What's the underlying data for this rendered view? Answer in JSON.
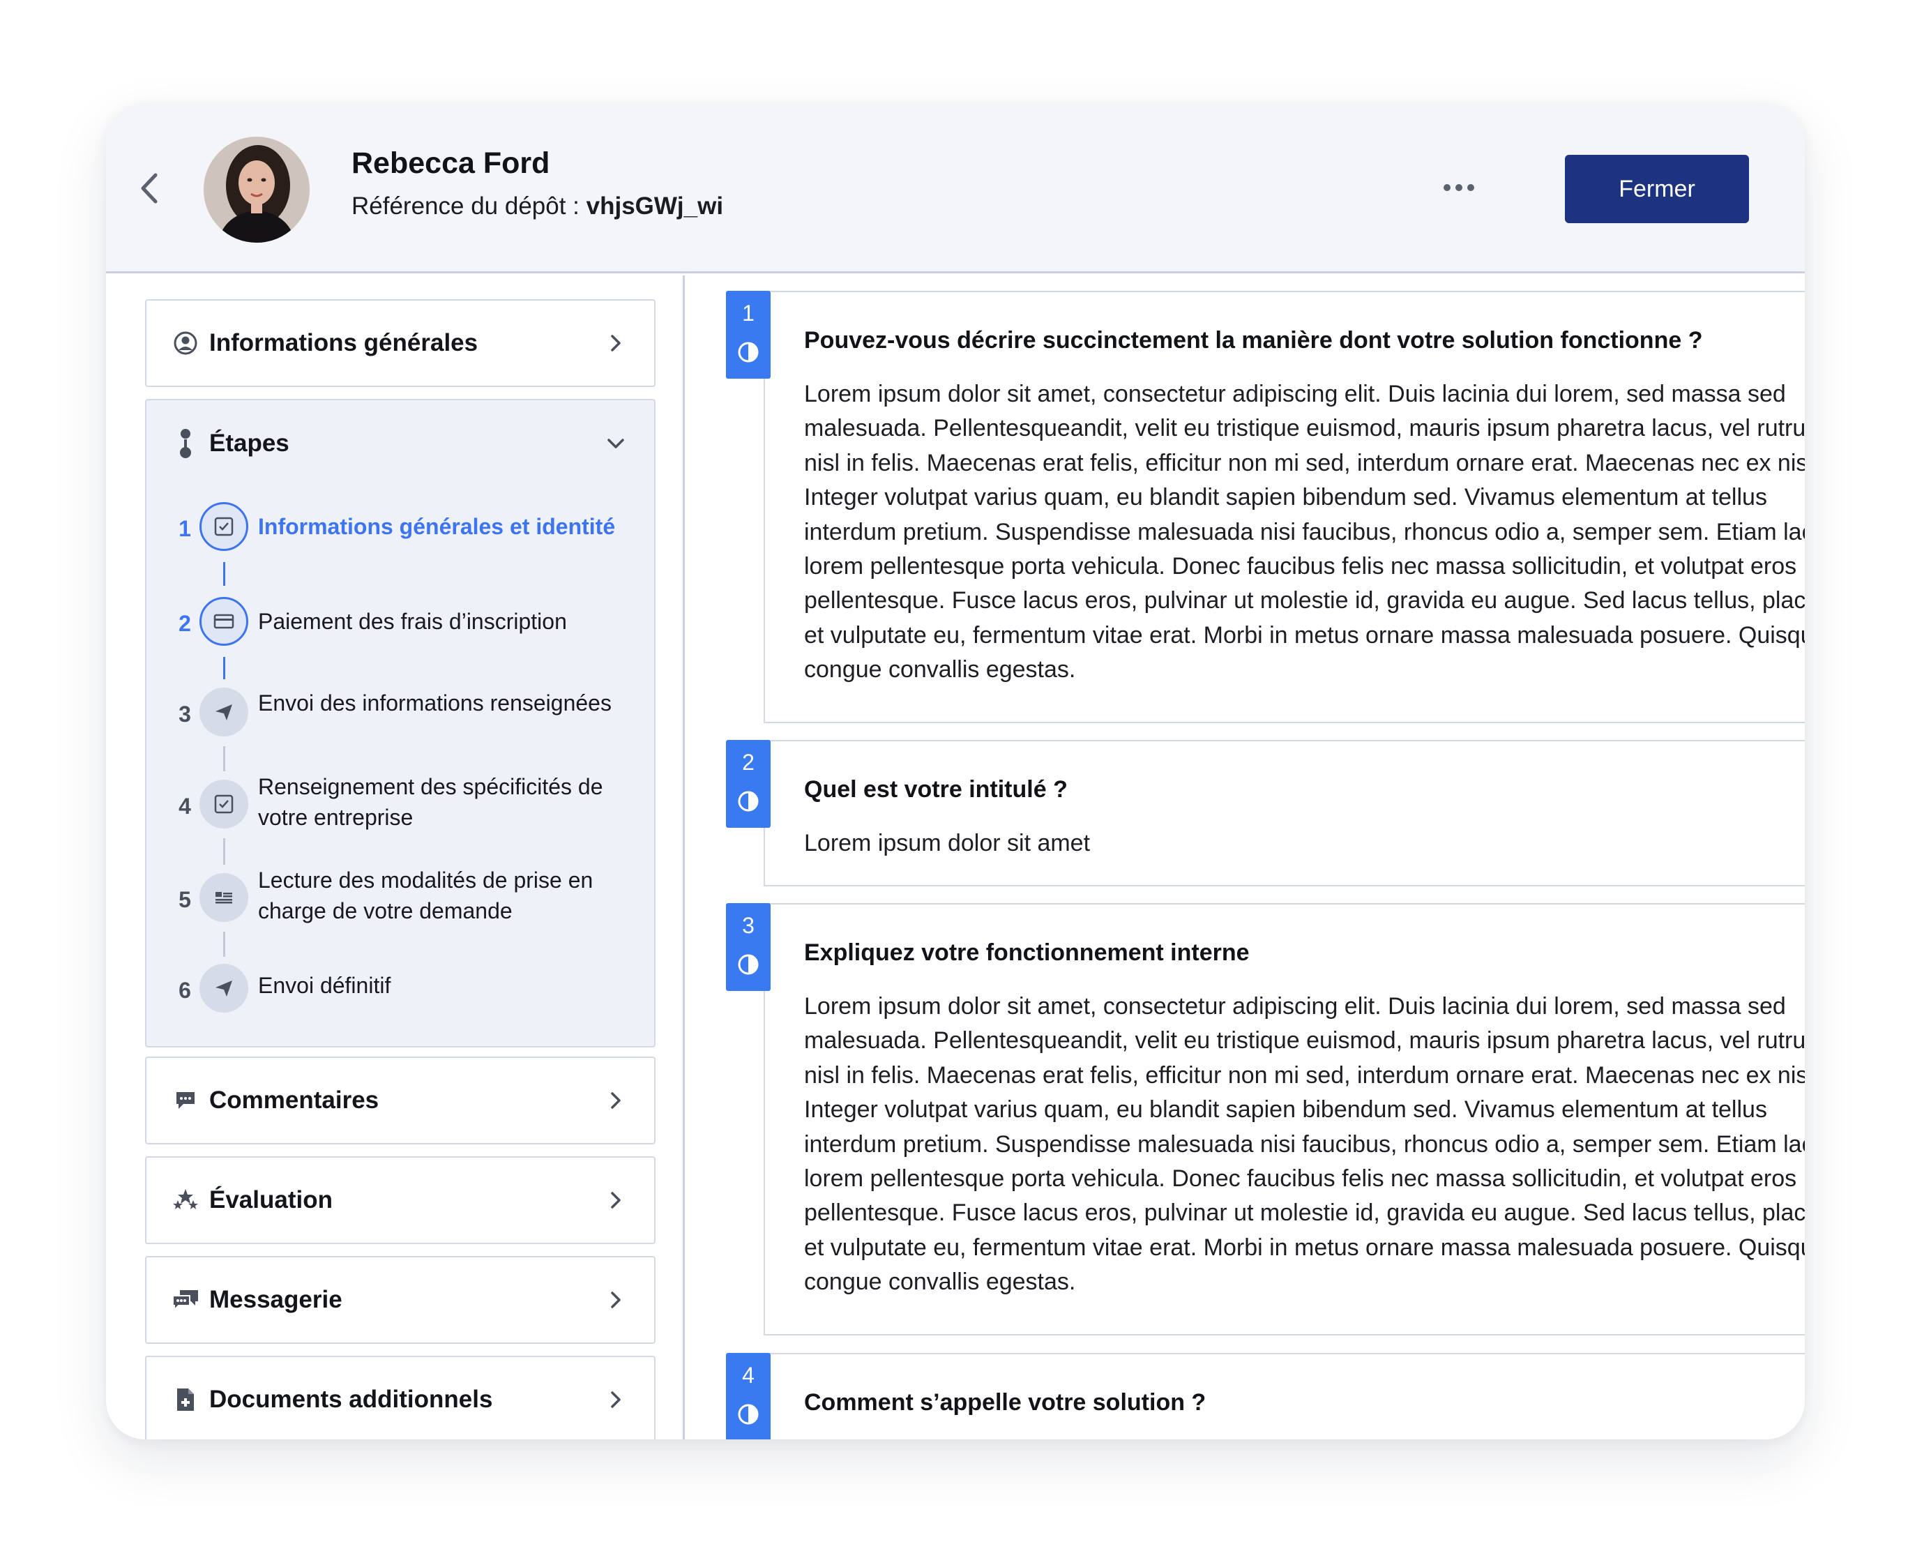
{
  "header": {
    "user_name": "Rebecca Ford",
    "reference_label": "Référence du dépôt : ",
    "reference_value": "vhjsGWj_wi",
    "close_label": "Fermer"
  },
  "sidebar": {
    "general_info": "Informations générales",
    "steps_title": "Étapes",
    "steps": [
      {
        "num": "1",
        "label": "Informations générales et identité",
        "icon": "checkbox-icon"
      },
      {
        "num": "2",
        "label": "Paiement des frais d’inscription",
        "icon": "credit-card-icon"
      },
      {
        "num": "3",
        "label": "Envoi des informations renseignées",
        "icon": "send-icon"
      },
      {
        "num": "4",
        "label": "Renseignement des spécificités de votre entreprise",
        "icon": "checkbox-icon"
      },
      {
        "num": "5",
        "label": "Lecture des modalités de prise en charge de votre demande",
        "icon": "document-list-icon"
      },
      {
        "num": "6",
        "label": "Envoi définitif",
        "icon": "send-icon"
      }
    ],
    "comments": "Commentaires",
    "evaluation": "Évaluation",
    "messaging": "Messagerie",
    "additional_docs": "Documents additionnels"
  },
  "questions": [
    {
      "num": "1",
      "title": "Pouvez-vous décrire succinctement la manière dont votre solution fonctionne ?",
      "answer": "Lorem ipsum dolor sit amet, consectetur adipiscing elit. Duis lacinia dui lorem, sed massa sed malesuada. Pellentesqueandit, velit eu tristique euismod, mauris ipsum pharetra lacus, vel rutrum mi nisl in felis. Maecenas erat felis, efficitur non mi sed, interdum ornare erat. Maecenas nec ex nisl. Integer volutpat varius quam, eu blandit sapien bibendum sed. Vivamus elementum at tellus interdum pretium. Suspendisse malesuada nisi faucibus, rhoncus odio a, semper sem. Etiam laoreet lorem pellentesque porta vehicula. Donec faucibus felis nec massa sollicitudin, et volutpat eros pellentesque. Fusce lacus eros, pulvinar ut molestie id, gravida eu augue. Sed lacus tellus, placerat et vulputate eu, fermentum vitae erat. Morbi in metus ornare massa malesuada posuere. Quisque congue convallis egestas."
    },
    {
      "num": "2",
      "title": "Quel est votre intitulé ?",
      "answer": "Lorem ipsum dolor sit amet"
    },
    {
      "num": "3",
      "title": "Expliquez votre fonctionnement interne",
      "answer": "Lorem ipsum dolor sit amet, consectetur adipiscing elit. Duis lacinia dui lorem, sed massa sed malesuada. Pellentesqueandit, velit eu tristique euismod, mauris ipsum pharetra lacus, vel rutrum mi nisl in felis. Maecenas erat felis, efficitur non mi sed, interdum ornare erat. Maecenas nec ex nisl. Integer volutpat varius quam, eu blandit sapien bibendum sed. Vivamus elementum at tellus interdum pretium. Suspendisse malesuada nisi faucibus, rhoncus odio a, semper sem. Etiam laoreet lorem pellentesque porta vehicula. Donec faucibus felis nec massa sollicitudin, et volutpat eros pellentesque. Fusce lacus eros, pulvinar ut molestie id, gravida eu augue. Sed lacus tellus, placerat et vulputate eu, fermentum vitae erat. Morbi in metus ornare massa malesuada posuere. Quisque congue convallis egestas."
    },
    {
      "num": "4",
      "title": "Comment s’appelle votre solution ?",
      "answer": ""
    }
  ],
  "colors": {
    "primary_button": "#1c3480",
    "accent_blue": "#3a7af0",
    "header_bg": "#f3f5f9"
  }
}
